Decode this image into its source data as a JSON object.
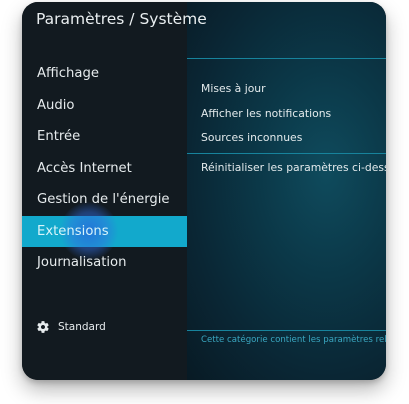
{
  "window": {
    "title": "Paramètres / Système"
  },
  "sidebar": {
    "items": [
      {
        "label": "Affichage"
      },
      {
        "label": "Audio"
      },
      {
        "label": "Entrée"
      },
      {
        "label": "Accès Internet"
      },
      {
        "label": "Gestion de l'énergie"
      },
      {
        "label": "Extensions",
        "active": true
      },
      {
        "label": "Journalisation"
      }
    ],
    "level_label": "Standard",
    "level_icon": "gear-icon"
  },
  "main": {
    "settings": [
      {
        "label": "Mises à jour"
      },
      {
        "label": "Afficher les notifications"
      },
      {
        "label": "Sources inconnues"
      },
      {
        "label": "Réinitialiser les paramètres ci-dessus"
      }
    ],
    "footer_description": "Cette catégorie contient les paramètres relatifs"
  },
  "colors": {
    "accent": "#12a9cc",
    "ripple": "#3c6fd8",
    "sidebar_bg": "#121a20",
    "main_bg": "#0b3848",
    "divider": "#17839c",
    "footer_text": "#3aa7c1"
  }
}
